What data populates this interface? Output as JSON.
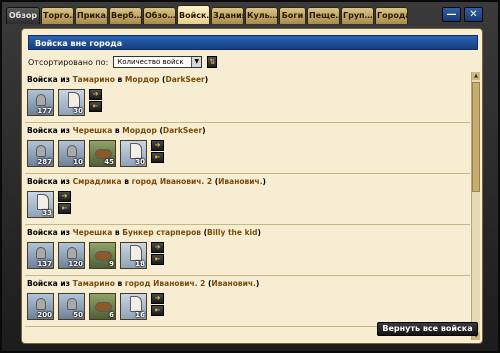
{
  "tabs": [
    {
      "label": "Обзор",
      "active": false
    },
    {
      "label": "Торго…",
      "active": false
    },
    {
      "label": "Прика…",
      "active": false
    },
    {
      "label": "Верб…",
      "active": false
    },
    {
      "label": "Обзо…",
      "active": false
    },
    {
      "label": "Войск…",
      "active": true
    },
    {
      "label": "Здания",
      "active": false
    },
    {
      "label": "Куль…",
      "active": false
    },
    {
      "label": "Боги",
      "active": false
    },
    {
      "label": "Пеще…",
      "active": false
    },
    {
      "label": "Груп…",
      "active": false
    },
    {
      "label": "Города",
      "active": false
    }
  ],
  "window": {
    "minimize": "—",
    "close": "✕"
  },
  "panel": {
    "title": "Войска вне города",
    "sort_label": "Отсортировано по:",
    "sort_value": "Количество войск",
    "sort_arrow": "▼",
    "sort_btn": "⇅"
  },
  "groups": [
    {
      "pre": "Войска из ",
      "from": "Тамарино",
      "mid": " в ",
      "to": "Мордор",
      "owner_open": " (",
      "owner": "DarkSeer",
      "owner_close": ")",
      "units": [
        {
          "count": "177",
          "kind": "arch"
        },
        {
          "count": "30",
          "kind": "ship"
        }
      ]
    },
    {
      "pre": "Войска из ",
      "from": "Черешка",
      "mid": " в ",
      "to": "Мордор",
      "owner_open": " (",
      "owner": "DarkSeer",
      "owner_close": ")",
      "units": [
        {
          "count": "287",
          "kind": "arch"
        },
        {
          "count": "10",
          "kind": "arch"
        },
        {
          "count": "45",
          "kind": "cav"
        },
        {
          "count": "30",
          "kind": "ship"
        }
      ]
    },
    {
      "pre": "Войска из ",
      "from": "Смрадлика",
      "mid": " в ",
      "to": "город Иванович. 2",
      "owner_open": " (",
      "owner": "Иванович.",
      "owner_close": ")",
      "units": [
        {
          "count": "33",
          "kind": "ship"
        }
      ]
    },
    {
      "pre": "Войска из ",
      "from": "Черешка",
      "mid": " в ",
      "to": "Бункер старперов",
      "owner_open": " (",
      "owner": "Billy the kid",
      "owner_close": ")",
      "units": [
        {
          "count": "137",
          "kind": "arch"
        },
        {
          "count": "120",
          "kind": "arch"
        },
        {
          "count": "9",
          "kind": "cav"
        },
        {
          "count": "18",
          "kind": "ship"
        }
      ]
    },
    {
      "pre": "Войска из ",
      "from": "Тамарино",
      "mid": " в ",
      "to": "город Иванович. 2",
      "owner_open": " (",
      "owner": "Иванович.",
      "owner_close": ")",
      "units": [
        {
          "count": "200",
          "kind": "arch"
        },
        {
          "count": "50",
          "kind": "arch"
        },
        {
          "count": "6",
          "kind": "cav"
        },
        {
          "count": "16",
          "kind": "ship"
        }
      ]
    }
  ],
  "action_icons": {
    "send": "➔",
    "return": "⇤"
  },
  "scroll": {
    "up": "▲",
    "down": "▼"
  },
  "return_all": "Вернуть все войска"
}
